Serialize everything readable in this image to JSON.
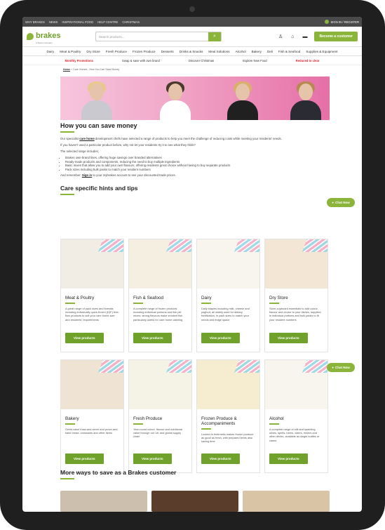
{
  "topbar": {
    "links": [
      "WHY BRAKES",
      "NEWS",
      "INSPIRATIONAL FOOD",
      "HELP CENTRE",
      "CHRISTMAS"
    ],
    "signin": "SIGN IN / REGISTER"
  },
  "header": {
    "logo": "brakes",
    "logo_sub": "a Sysco company",
    "search_placeholder": "Search products...",
    "become": "Become a customer"
  },
  "categories": [
    "Dairy",
    "Meat & Poultry",
    "Dry Store",
    "Fresh Produce",
    "Frozen Produce",
    "Desserts",
    "Drinks & Snacks",
    "Meal Solutions",
    "Alcohol",
    "Bakery",
    "Deli",
    "Fish & Seafood",
    "Supplies & Equipment"
  ],
  "promos": [
    "Monthly Promotions",
    "Swap & save with own brand",
    "Discover Christmas",
    "Explore New Food",
    "Reduced to clear"
  ],
  "breadcrumb": {
    "home": "Home",
    "rest": " > Care Homes - How You Can Save Money"
  },
  "main": {
    "title": "How you can save money",
    "p1_a": "Our specialist ",
    "p1_link": "care home",
    "p1_b": " development chefs have selected a range of products to help you meet the challenge of reducing costs while meeting your residents' needs.",
    "p2": "If you haven't used a particular product before, why not let your residents try it to see what they think?",
    "p3": "The selected range includes;",
    "bullets": [
      "Brakes own-brand lines, offering huge savings over branded alternatives",
      "Ready-made products and components, reducing the need to buy multiple ingredients",
      "Basic mixes that allow you to add your own flavours, offering residents great choice without having to buy separate products",
      "Pack sizes including bulk packs to match your resident numbers"
    ],
    "p4_a": "And remember: ",
    "p4_link": "Sign in",
    "p4_b": " to your mybrakes account to see your discounted trade prices.",
    "hints_title": "Care specific hints and tips"
  },
  "cards": [
    {
      "title": "Meat & Poultry",
      "desc": "A great range of pack sizes and formats including individually quick-frozen (IQF) free-flow products to suit your care home size and residents' requirements",
      "button": "View products"
    },
    {
      "title": "Fish & Seafood",
      "desc": "A complete range of frozen products including individual portions and fish pie mixes; strong flavours make smoked fish particularly useful for care home catering",
      "button": "View products"
    },
    {
      "title": "Dairy",
      "desc": "Daily staples including milk, cheese and yoghurt, all widely used for dietary fortification, in pack sizes to match your needs and fridge space",
      "button": "View products"
    },
    {
      "title": "Dry Store",
      "desc": "Store-cupboard essentials to add colour, flavour and choice to your dishes, supplied in individual portions and bulk packs to fit your resident numbers",
      "button": "View products"
    },
    {
      "title": "Bakery",
      "desc": "Great-value thaw-and-serve and prove-and-bake bread, croissants and other items",
      "button": "View products"
    },
    {
      "title": "Fresh Produce",
      "desc": "Year-round colour, flavour and nutritional value through our UK and global supply chain",
      "button": "View products"
    },
    {
      "title": "Frozen Produce & Accompaniments",
      "desc": "Locked-in freshness makes frozen produce as good as fresh, with prepared items also saving time",
      "button": "View products"
    },
    {
      "title": "Alcohol",
      "desc": "A complete range of still and sparkling wines, spirits, beers, ciders, mixers and other drinks, available as single bottles or cases",
      "button": "View products"
    }
  ],
  "chat": "Chat Now",
  "more_title": "More ways to save as a Brakes customer",
  "colors": {
    "brand_green": "#8ab53a",
    "promo_red": "#d9262f",
    "hero_pink": "#e66fa7"
  }
}
